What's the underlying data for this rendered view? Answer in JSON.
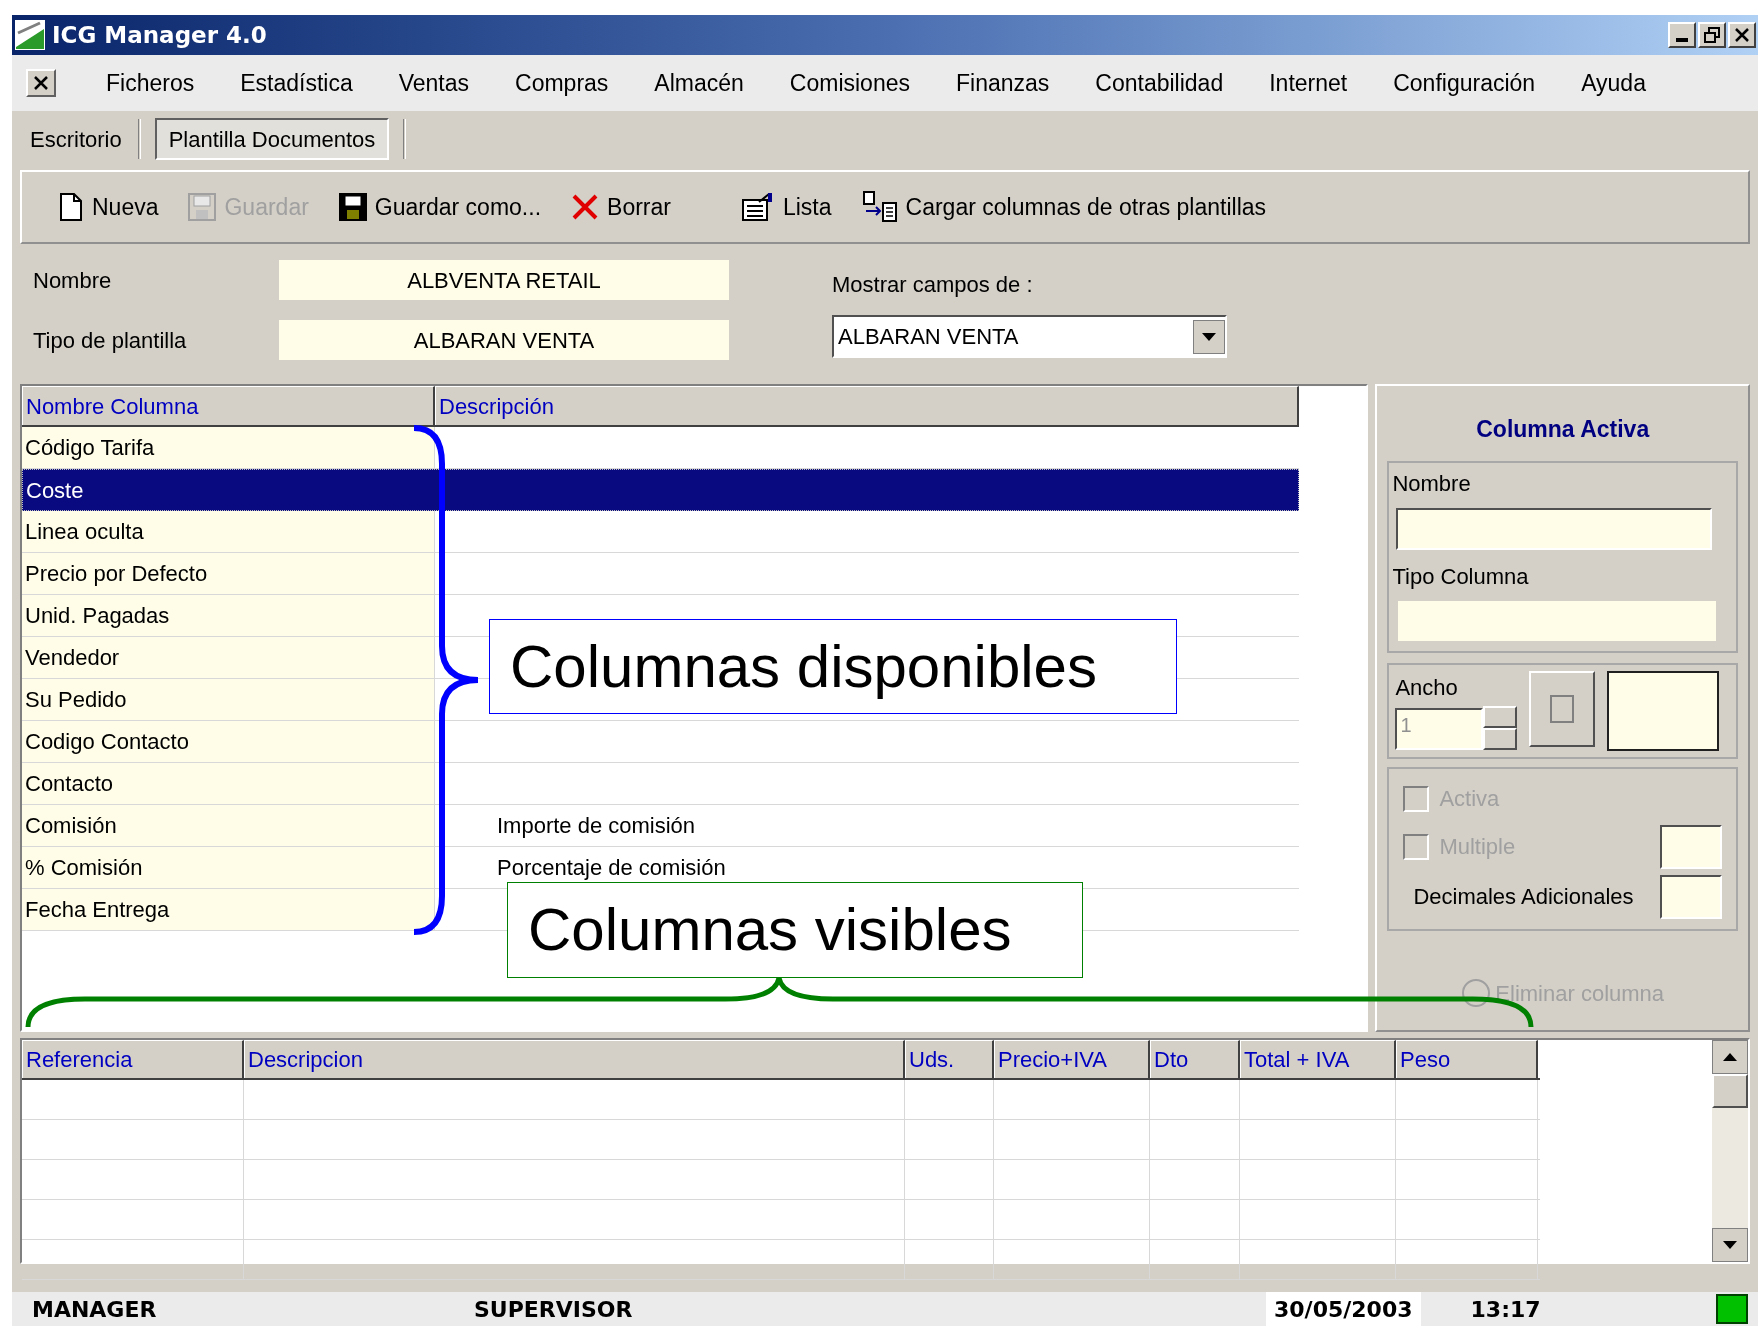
{
  "window": {
    "title": "ICG Manager 4.0"
  },
  "menu": [
    "Ficheros",
    "Estadística",
    "Ventas",
    "Compras",
    "Almacén",
    "Comisiones",
    "Finanzas",
    "Contabilidad",
    "Internet",
    "Configuración",
    "Ayuda"
  ],
  "tabs": [
    {
      "label": "Escritorio",
      "selected": false
    },
    {
      "label": "Plantilla Documentos",
      "selected": true
    }
  ],
  "toolbar": [
    {
      "kind": "new",
      "label": "Nueva",
      "disabled": false
    },
    {
      "kind": "save",
      "label": "Guardar",
      "disabled": true
    },
    {
      "kind": "save-as",
      "label": "Guardar como...",
      "disabled": false
    },
    {
      "kind": "delete",
      "label": "Borrar",
      "disabled": false
    },
    {
      "kind": "list",
      "label": "Lista",
      "disabled": false
    },
    {
      "kind": "load",
      "label": "Cargar columnas de otras plantillas",
      "disabled": false
    }
  ],
  "form": {
    "name": {
      "label": "Nombre",
      "value": "ALBVENTA RETAIL"
    },
    "template_type": {
      "label": "Tipo de plantilla",
      "value": "ALBARAN VENTA"
    },
    "show_fields": {
      "label": "Mostrar campos de :",
      "value": "ALBARAN VENTA"
    }
  },
  "available_columns": {
    "columns": [
      "Nombre Columna",
      "Descripción"
    ],
    "rows": [
      {
        "name": "Código Tarifa",
        "selected": false
      },
      {
        "name": "Coste",
        "selected": true
      },
      {
        "name": "Linea oculta",
        "selected": false
      },
      {
        "name": "Precio por Defecto",
        "selected": false
      },
      {
        "name": "Unid. Pagadas",
        "selected": false
      },
      {
        "name": "Vendedor",
        "selected": false
      },
      {
        "name": "Su Pedido",
        "selected": false
      },
      {
        "name": "Codigo Contacto",
        "selected": false
      },
      {
        "name": "Contacto",
        "selected": false
      },
      {
        "name": "Comisión",
        "description": "Importe de comisión",
        "selected": false
      },
      {
        "name": "% Comisión",
        "description": "Porcentaje de comisión",
        "selected": false
      },
      {
        "name": "Fecha Entrega",
        "selected": false
      }
    ]
  },
  "active_column": {
    "title": "Columna Activa",
    "name_label": "Nombre",
    "type_label": "Tipo Columna",
    "width_label": "Ancho",
    "width_value": "1",
    "options": [
      {
        "label": "Activa",
        "checked": false,
        "disabled": true
      },
      {
        "label": "Multiple",
        "checked": false,
        "disabled": true
      }
    ],
    "decimals_label": "Decimales Adicionales",
    "remove_button": {
      "label": "Eliminar columna",
      "disabled": true
    }
  },
  "visible_columns": {
    "columns": [
      "Referencia",
      "Descripcion",
      "Uds.",
      "Precio+IVA",
      "Dto",
      "Total + IVA",
      "Peso"
    ]
  },
  "annotations": [
    {
      "text": "Columnas disponibles",
      "color": "#0000ff"
    },
    {
      "text": "Columnas visibles",
      "color": "#008000"
    }
  ],
  "status_bar": {
    "user": "MANAGER",
    "role": "SUPERVISOR",
    "date": "30/05/2003",
    "time": "13:17"
  }
}
